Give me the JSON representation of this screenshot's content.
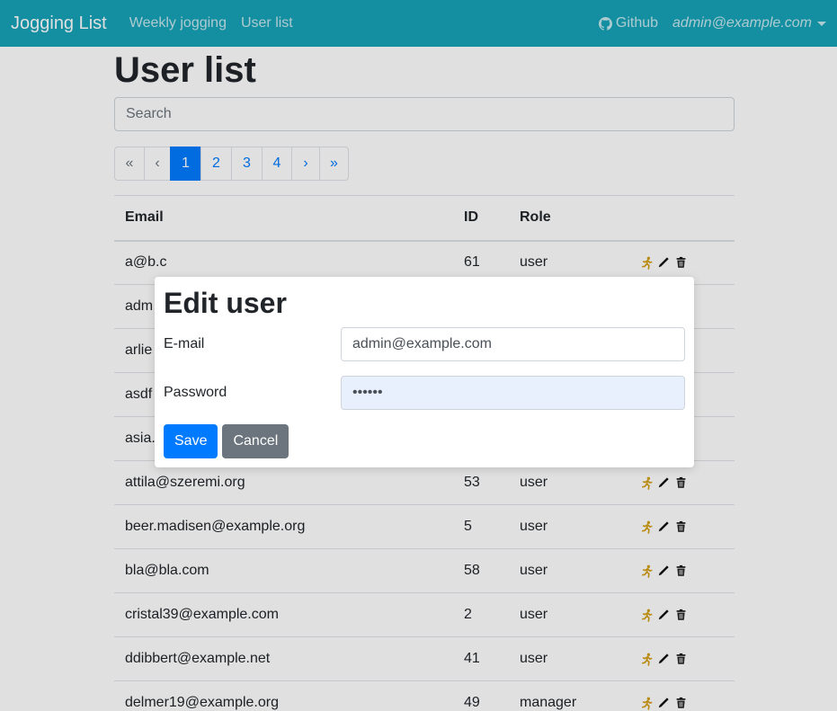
{
  "nav": {
    "brand": "Jogging List",
    "links": [
      "Weekly jogging",
      "User list"
    ],
    "github": "Github",
    "user": "admin@example.com"
  },
  "page": {
    "title": "User list",
    "search_placeholder": "Search"
  },
  "pagination": {
    "first": "«",
    "prev": "‹",
    "pages": [
      "1",
      "2",
      "3",
      "4"
    ],
    "active_page": "1",
    "next": "›",
    "last": "»"
  },
  "table": {
    "headers": [
      "Email",
      "ID",
      "Role",
      ""
    ],
    "rows": [
      {
        "email": "a@b.c",
        "id": "61",
        "role": "user"
      },
      {
        "email": "adm",
        "id": "",
        "role": ""
      },
      {
        "email": "arlie",
        "id": "",
        "role": ""
      },
      {
        "email": "asdf",
        "id": "",
        "role": ""
      },
      {
        "email": "asia.",
        "id": "",
        "role": ""
      },
      {
        "email": "attila@szeremi.org",
        "id": "53",
        "role": "user"
      },
      {
        "email": "beer.madisen@example.org",
        "id": "5",
        "role": "user"
      },
      {
        "email": "bla@bla.com",
        "id": "58",
        "role": "user"
      },
      {
        "email": "cristal39@example.com",
        "id": "2",
        "role": "user"
      },
      {
        "email": "ddibbert@example.net",
        "id": "41",
        "role": "user"
      },
      {
        "email": "delmer19@example.org",
        "id": "49",
        "role": "manager"
      }
    ],
    "action_icons": [
      "running-icon",
      "pencil-icon",
      "trash-icon"
    ]
  },
  "modal": {
    "title": "Edit user",
    "email_label": "E-mail",
    "email_value": "admin@example.com",
    "password_label": "Password",
    "password_value": "••••••",
    "save": "Save",
    "cancel": "Cancel"
  },
  "colors": {
    "navbar": "#17a2b8",
    "primary": "#007bff",
    "secondary": "#6c757d"
  }
}
